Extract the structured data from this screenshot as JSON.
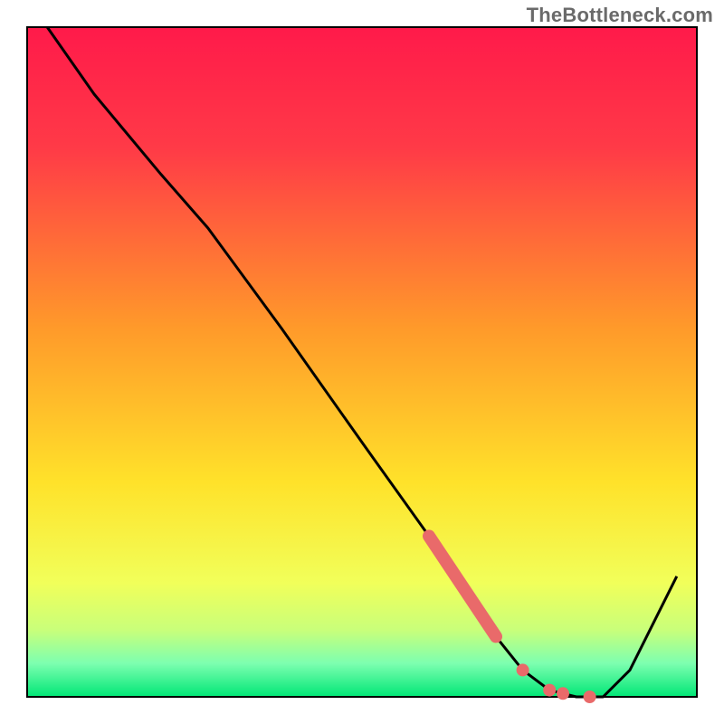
{
  "watermark": "TheBottleneck.com",
  "chart_data": {
    "type": "line",
    "title": "",
    "xlabel": "",
    "ylabel": "",
    "xlim": [
      0,
      100
    ],
    "ylim": [
      0,
      100
    ],
    "grid": false,
    "legend": false,
    "annotations": [],
    "background_gradient_top": "#ff1a4a",
    "background_gradient_mid": "#ffd500",
    "background_gradient_bottom": "#00e676",
    "series": [
      {
        "name": "bottleneck-curve",
        "color": "#000000",
        "x": [
          3,
          10,
          20,
          27,
          38,
          50,
          60,
          66,
          70,
          74,
          78,
          82,
          86,
          90,
          97
        ],
        "y": [
          100,
          90,
          78,
          70,
          55,
          38,
          24,
          15,
          9,
          4,
          1,
          0,
          0,
          4,
          18
        ]
      }
    ],
    "highlight_segment": {
      "name": "highlight-thick",
      "color": "#e96a6a",
      "x": [
        60,
        66,
        70
      ],
      "y": [
        24,
        15,
        9
      ]
    },
    "highlight_dots": {
      "name": "highlight-dots",
      "color": "#e96a6a",
      "points": [
        {
          "x": 74,
          "y": 4
        },
        {
          "x": 78,
          "y": 1
        },
        {
          "x": 80,
          "y": 0.5
        },
        {
          "x": 84,
          "y": 0
        }
      ]
    }
  }
}
